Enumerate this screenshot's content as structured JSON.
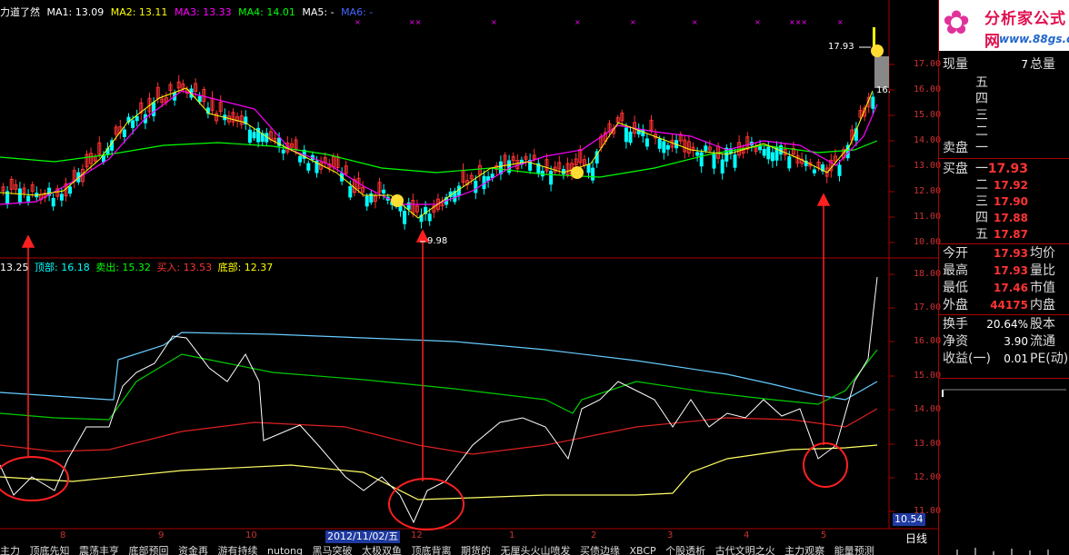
{
  "ma_legend": {
    "title": "力道了然",
    "items": [
      {
        "label": "MA1: 13.09",
        "color": "#ffffff"
      },
      {
        "label": "MA2: 13.11",
        "color": "#ffff00"
      },
      {
        "label": "MA3: 13.33",
        "color": "#ff00ff"
      },
      {
        "label": "MA4: 14.01",
        "color": "#00ff00"
      },
      {
        "label": "MA5: -",
        "color": "#ffffff"
      },
      {
        "label": "MA6: -",
        "color": "#4466ff"
      }
    ]
  },
  "indicator_legend": {
    "items": [
      {
        "label": "13.25",
        "color": "#ffffff"
      },
      {
        "label": "顶部: 16.18",
        "color": "#00ffff"
      },
      {
        "label": "卖出: 15.32",
        "color": "#00ff00"
      },
      {
        "label": "买入: 13.53",
        "color": "#ff3333"
      },
      {
        "label": "底部: 12.37",
        "color": "#ffff00"
      }
    ]
  },
  "price_annotations": {
    "high": "17.93",
    "low": "9.98",
    "partial": "16."
  },
  "upper_y_axis": [
    "17.00",
    "16.00",
    "15.00",
    "14.00",
    "13.00",
    "12.00",
    "11.00",
    "10.00"
  ],
  "lower_y_axis": [
    "18.00",
    "17.00",
    "16.00",
    "15.00",
    "14.00",
    "13.00",
    "12.00",
    "11.00"
  ],
  "x_axis": [
    "8",
    "9",
    "10",
    "12",
    "1",
    "2",
    "3",
    "4",
    "5"
  ],
  "date_tag": "2012/11/02/五",
  "bottom_value_tag": "10.54",
  "period_tab": "日线",
  "formula_bar": [
    "主力",
    "顶底先知",
    "震荡丰亨",
    "底部预回",
    "资金再",
    "游有持续",
    "nutong",
    "黑马突破",
    "太极双鱼",
    "顶底背离",
    "期货的",
    "无厘头火山喷发",
    "买债边缘",
    "XBCP",
    "个股透析",
    "古代文明之火",
    "主力观察",
    "能量预测"
  ],
  "right_panel": {
    "logo_text": "分析家公式网",
    "logo_url": "www.88gs.com",
    "current_volume_label": "现量",
    "current_volume": "7",
    "total_volume_label": "总量",
    "sell_label": "卖盘",
    "buy_label": "买盘",
    "sell_levels": [
      "五",
      "四",
      "三",
      "二",
      "一"
    ],
    "buy_levels": [
      {
        "level": "一",
        "price": "17.93"
      },
      {
        "level": "二",
        "price": "17.92"
      },
      {
        "level": "三",
        "price": "17.90"
      },
      {
        "level": "四",
        "price": "17.88"
      },
      {
        "level": "五",
        "price": "17.87"
      }
    ],
    "stats": [
      {
        "label": "今开",
        "value": "17.93",
        "rlabel": "均价"
      },
      {
        "label": "最高",
        "value": "17.93",
        "rlabel": "量比"
      },
      {
        "label": "最低",
        "value": "17.46",
        "rlabel": "市值"
      },
      {
        "label": "外盘",
        "value": "44175",
        "rlabel": "内盘"
      }
    ],
    "stats2": [
      {
        "label": "换手",
        "value": "20.64%",
        "rlabel": "股本"
      },
      {
        "label": "净资",
        "value": "3.90",
        "rlabel": "流通"
      },
      {
        "label": "收益(一)",
        "value": "0.01",
        "rlabel": "PE(动)"
      }
    ]
  },
  "colors": {
    "up": "#ff3333",
    "down": "#00ffff",
    "ma1": "#ffffff",
    "ma2": "#ffff00",
    "ma3": "#ff00ff",
    "ma4": "#00ff00",
    "arrow": "#ff2020",
    "top_line": "#66ccff",
    "sell_line": "#00cc00",
    "buy_line": "#dd2020",
    "bottom_line": "#ffff66"
  }
}
